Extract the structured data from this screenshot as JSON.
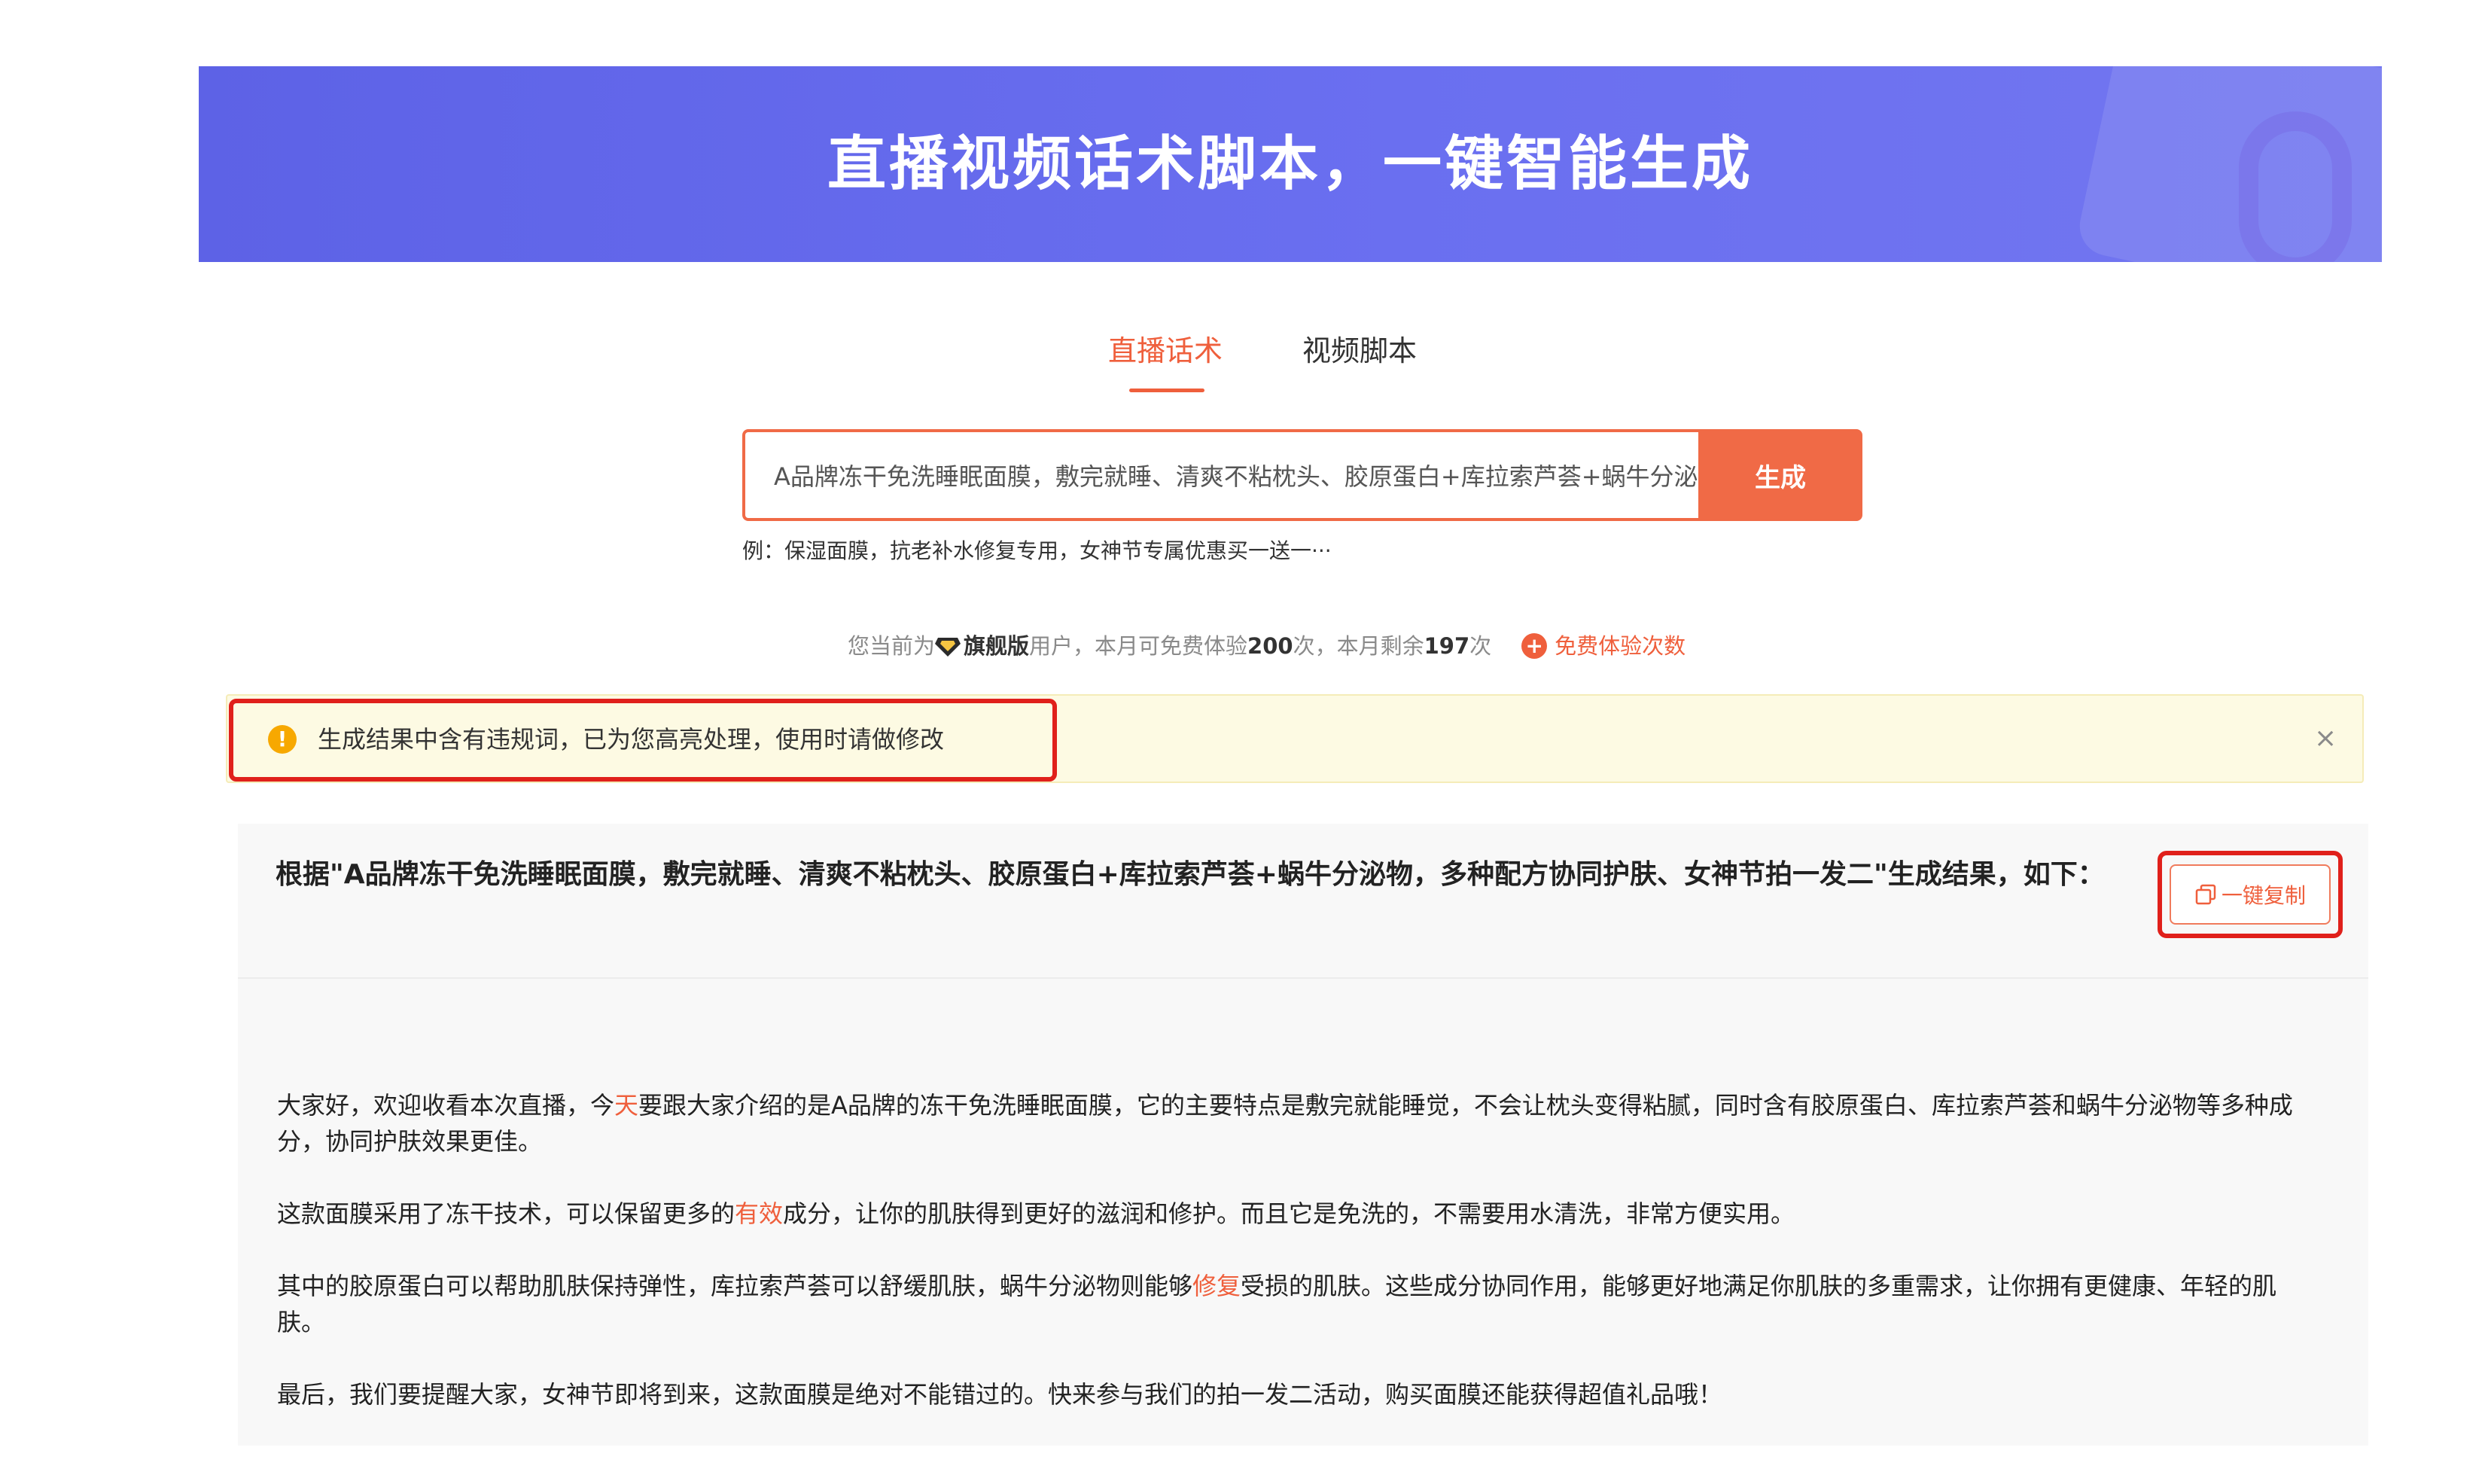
{
  "banner": {
    "title": "直播视频话术脚本，一键智能生成"
  },
  "tabs": [
    {
      "label": "直播话术",
      "active": true
    },
    {
      "label": "视频脚本",
      "active": false
    }
  ],
  "search": {
    "value": "A品牌冻干免洗睡眠面膜，敷完就睡、清爽不粘枕头、胶原蛋白+库拉索芦荟+蜗牛分泌物，多种配方协同护肤、女神节拍一发二",
    "button_label": "生成",
    "example": "例：保湿面膜，抗老补水修复专用，女神节专属优惠买一送一···"
  },
  "quota": {
    "prefix": "您当前为",
    "plan": "旗舰版",
    "mid1": "用户，本月可免费体验",
    "total": "200",
    "mid2": "次，本月剩余",
    "remaining": "197",
    "suffix": "次",
    "free_link": "免费体验次数"
  },
  "warning": {
    "text": "生成结果中含有违规词，已为您高亮处理，使用时请做修改",
    "close": "×"
  },
  "result": {
    "heading": "根据\"A品牌冻干免洗睡眠面膜，敷完就睡、清爽不粘枕头、胶原蛋白+库拉索芦荟+蜗牛分泌物，多种配方协同护肤、女神节拍一发二\"生成结果，如下：",
    "copy_label": "一键复制",
    "p1": {
      "a": "大家好，欢迎收看本次直播，今",
      "hl": "天",
      "b": "要跟大家介绍的是A品牌的冻干免洗睡眠面膜，它的主要特点是敷完就能睡觉，不会让枕头变得粘腻，同时含有胶原蛋白、库拉索芦荟和蜗牛分泌物等多种成分，协同护肤效果更佳。"
    },
    "p2": {
      "a": "这款面膜采用了冻干技术，可以保留更多的",
      "hl": "有效",
      "b": "成分，让你的肌肤得到更好的滋润和修护。而且它是免洗的，不需要用水清洗，非常方便实用。"
    },
    "p3": {
      "a": "其中的胶原蛋白可以帮助肌肤保持弹性，库拉索芦荟可以舒缓肌肤，蜗牛分泌物则能够",
      "hl": "修复",
      "b": "受损的肌肤。这些成分协同作用，能够更好地满足你肌肤的多重需求，让你拥有更健康、年轻的肌肤。"
    },
    "p4": "最后，我们要提醒大家，女神节即将到来，这款面膜是绝对不能错过的。快来参与我们的拍一发二活动，购买面膜还能获得超值礼品哦！"
  },
  "colors": {
    "accent": "#ef5f3c",
    "banner": "#6368ea",
    "warning_bg": "#fdfae3",
    "highlight_box": "#e0201b"
  }
}
